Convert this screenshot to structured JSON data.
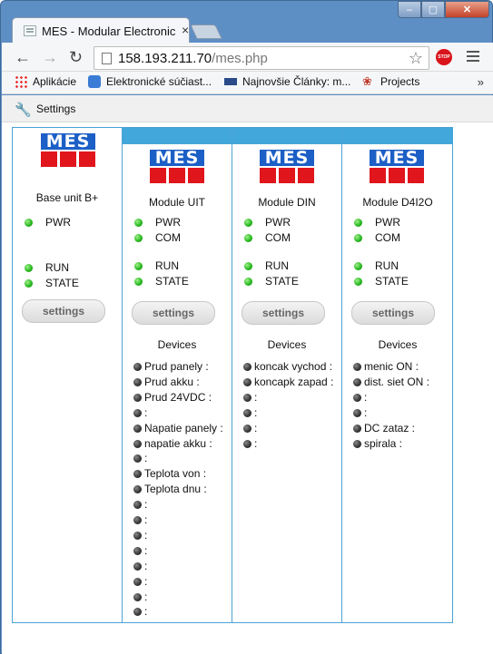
{
  "browser": {
    "tab_title": "MES - Modular Electronic",
    "tab_close": "×",
    "url_host": "158.193.211.70",
    "url_path": "/mes.php",
    "window_min": "‒",
    "window_max": "▢",
    "window_close": "✕",
    "stop_label": "STOP",
    "bookmarks": [
      {
        "label": "Aplikácie",
        "icon": "apps-grid-icon"
      },
      {
        "label": "Elektronické súčiast...",
        "icon": "electronics-icon"
      },
      {
        "label": "Najnovšie Články: m...",
        "icon": "article-icon"
      },
      {
        "label": "Projects",
        "icon": "paw-icon"
      }
    ],
    "bookmarks_more": "»",
    "extension_bar": {
      "label": "Settings",
      "icon": "wrench-icon"
    }
  },
  "colors": {
    "accent": "#42a7db",
    "logo_blue": "#1c5fc6",
    "logo_red": "#e0161c",
    "led_green": "#22b51b"
  },
  "logo_text": "MES",
  "modules": [
    {
      "name": "Base unit B+",
      "leds": [
        "PWR",
        "RUN",
        "STATE"
      ],
      "button": "settings",
      "devices_title": "",
      "devices": []
    },
    {
      "name": "Module UIT",
      "leds": [
        "PWR",
        "COM",
        "RUN",
        "STATE"
      ],
      "button": "settings",
      "devices_title": "Devices",
      "devices": [
        "Prud panely :",
        "Prud akku :",
        "Prud 24VDC :",
        ":",
        "Napatie panely :",
        "napatie akku :",
        ":",
        "Teplota von :",
        "Teplota dnu :",
        ":",
        ":",
        ":",
        ":",
        ":",
        ":",
        ":",
        ":"
      ]
    },
    {
      "name": "Module DIN",
      "leds": [
        "PWR",
        "COM",
        "RUN",
        "STATE"
      ],
      "button": "settings",
      "devices_title": "Devices",
      "devices": [
        "koncak vychod :",
        "koncapk zapad :",
        ":",
        ":",
        ":",
        ":"
      ]
    },
    {
      "name": "Module D4I2O",
      "leds": [
        "PWR",
        "COM",
        "RUN",
        "STATE"
      ],
      "button": "settings",
      "devices_title": "Devices",
      "devices": [
        "menic ON :",
        "dist. siet ON :",
        ":",
        ":",
        "DC zataz :",
        "spirala :"
      ]
    }
  ]
}
